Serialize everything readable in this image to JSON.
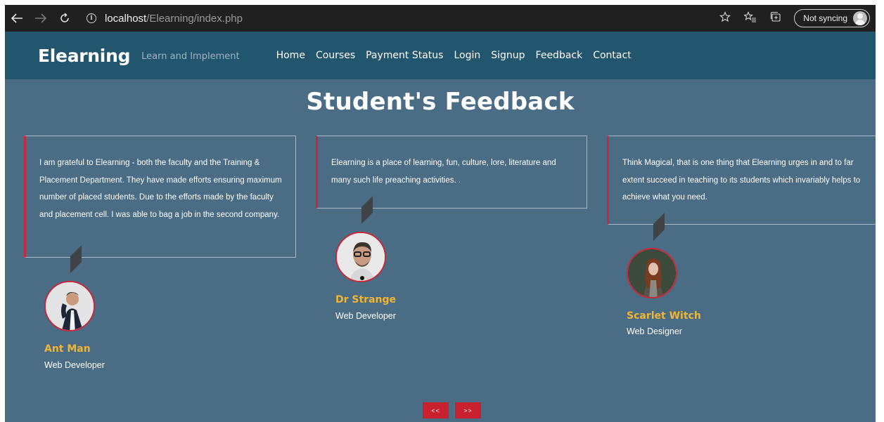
{
  "browser": {
    "back_icon": "back-arrow-icon",
    "forward_icon": "forward-arrow-icon",
    "refresh_icon": "refresh-icon",
    "url_host": "localhost",
    "url_path": "/Elearning/index.php",
    "sync_label": "Not syncing"
  },
  "header": {
    "brand": "Elearning",
    "tagline": "Learn and Implement",
    "nav": [
      "Home",
      "Courses",
      "Payment Status",
      "Login",
      "Signup",
      "Feedback",
      "Contact"
    ]
  },
  "feedback": {
    "title": "Student's Feedback",
    "items": [
      {
        "quote": "I am grateful to Elearning - both the faculty and the Training & Placement Department. They have made efforts ensuring maximum number of placed students. Due to the efforts made by the faculty and placement cell. I was able to bag a job in the second company.",
        "name": "Ant Man",
        "role": "Web Developer"
      },
      {
        "quote": "Elearning is a place of learning, fun, culture, lore, literature and many such life preaching activities. .",
        "name": "Dr Strange",
        "role": "Web Developer"
      },
      {
        "quote": "Think Magical, that is one thing that Elearning urges in and to far extent succeed in teaching to its students which invariably helps to achieve what you need.",
        "name": "Scarlet Witch",
        "role": "Web Designer"
      }
    ],
    "prev_label": "<<",
    "next_label": ">>"
  },
  "colors": {
    "site_bg": "#4a6d85",
    "header_bg": "#22566f",
    "accent_red": "#c8283c",
    "name_gold": "#f2b531"
  }
}
